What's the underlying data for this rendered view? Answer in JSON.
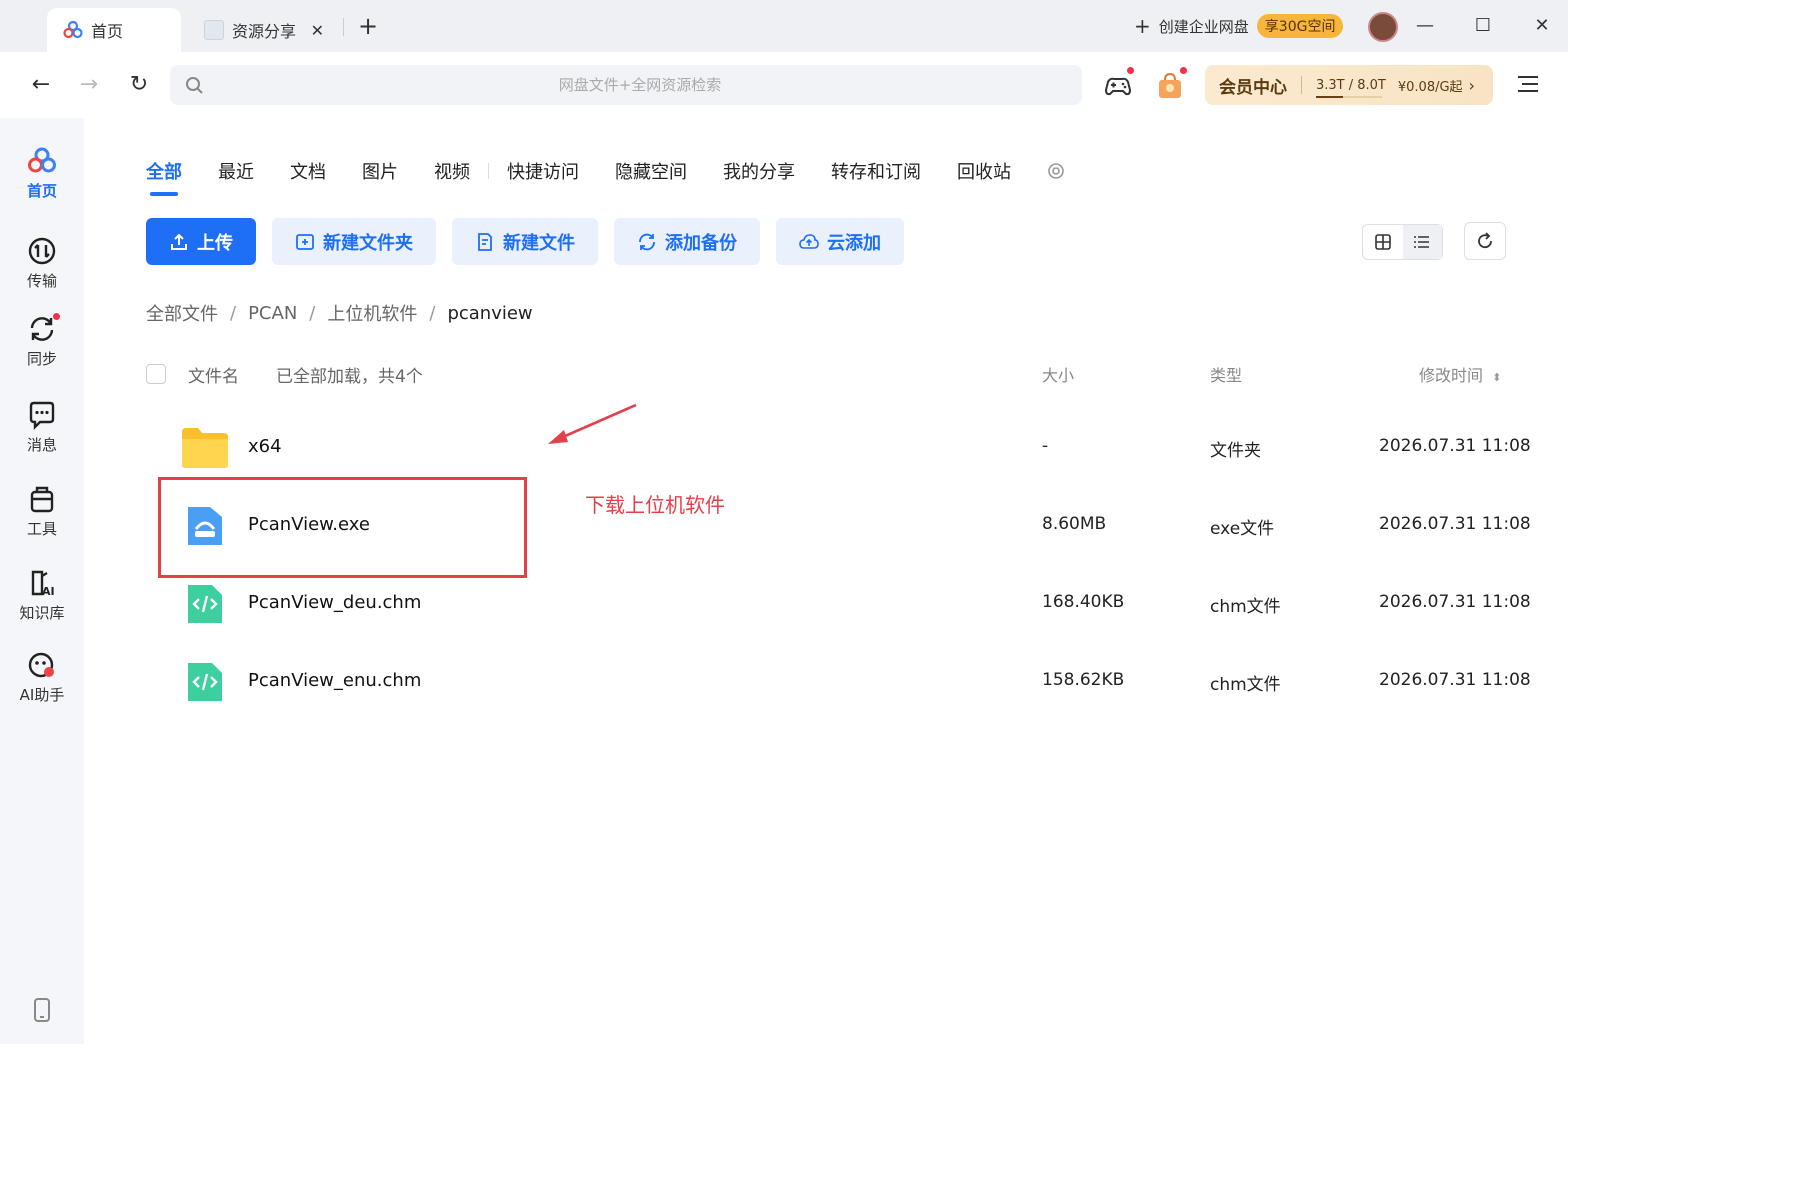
{
  "titlebar": {
    "tabs": [
      {
        "label": "首页",
        "active": true
      },
      {
        "label": "资源分享",
        "active": false
      }
    ],
    "new_tab_symbol": "+",
    "create_enterprise": "创建企业网盘",
    "promo_badge": "享30G空间",
    "window_controls": {
      "minimize": "—",
      "maximize": "☐",
      "close": "✕"
    }
  },
  "navbar": {
    "back_icon": "←",
    "forward_icon": "→",
    "reload_icon": "↻",
    "search_placeholder": "网盘文件+全网资源检索",
    "vip": {
      "label": "会员中心",
      "storage": "3.3T / 8.0T",
      "storage_used_fraction": 0.41,
      "price": "¥0.08/G起",
      "chevron": "›"
    }
  },
  "sidebar": {
    "items": [
      {
        "label": "首页",
        "icon": "home-clover-icon",
        "active": true
      },
      {
        "label": "传输",
        "icon": "transfer-icon",
        "active": false
      },
      {
        "label": "同步",
        "icon": "sync-icon",
        "active": false
      },
      {
        "label": "消息",
        "icon": "message-icon",
        "active": false
      },
      {
        "label": "工具",
        "icon": "toolbox-icon",
        "active": false
      },
      {
        "label": "知识库",
        "icon": "knowledge-ai-icon",
        "active": false
      },
      {
        "label": "AI助手",
        "icon": "ai-assistant-icon",
        "active": false
      }
    ]
  },
  "categories": [
    "全部",
    "最近",
    "文档",
    "图片",
    "视频",
    "快捷访问",
    "隐藏空间",
    "我的分享",
    "转存和订阅",
    "回收站"
  ],
  "actions": {
    "upload": "上传",
    "new_folder": "新建文件夹",
    "new_file": "新建文件",
    "add_backup": "添加备份",
    "cloud_add": "云添加"
  },
  "breadcrumb": [
    "全部文件",
    "PCAN",
    "上位机软件",
    "pcanview"
  ],
  "breadcrumb_separator": "/",
  "list_header": {
    "name": "文件名",
    "count": "已全部加载，共4个",
    "size": "大小",
    "type": "类型",
    "mtime": "修改时间"
  },
  "files": [
    {
      "name": "x64",
      "size": "-",
      "type": "文件夹",
      "mtime": "2026.07.31 11:08",
      "icon": "folder-icon"
    },
    {
      "name": "PcanView.exe",
      "size": "8.60MB",
      "type": "exe文件",
      "mtime": "2026.07.31 11:08",
      "icon": "exe-file-icon"
    },
    {
      "name": "PcanView_deu.chm",
      "size": "168.40KB",
      "type": "chm文件",
      "mtime": "2026.07.31 11:08",
      "icon": "code-file-icon"
    },
    {
      "name": "PcanView_enu.chm",
      "size": "158.62KB",
      "type": "chm文件",
      "mtime": "2026.07.31 11:08",
      "icon": "code-file-icon"
    }
  ],
  "annotation": {
    "text": "下载上位机软件",
    "color": "#e4404a"
  },
  "colors": {
    "accent": "#1e6ff5",
    "folder": "#fbc02d",
    "exe": "#4a9ff5",
    "chm": "#3ecf9e",
    "red_dot": "#f2304a"
  }
}
